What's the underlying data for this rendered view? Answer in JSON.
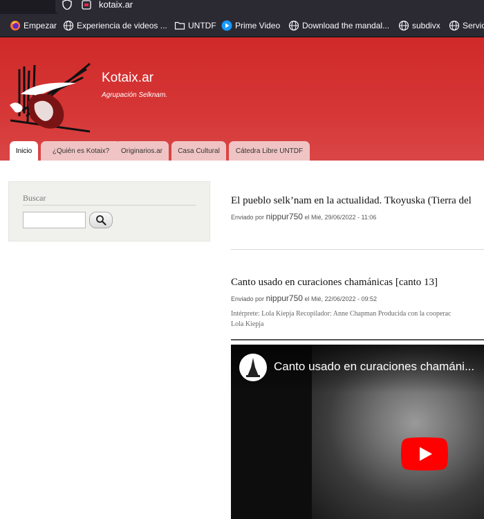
{
  "browser": {
    "url": "kotaix.ar",
    "bookmarks": [
      {
        "label": "Empezar",
        "icon": "firefox-icon"
      },
      {
        "label": "Experiencia de videos ...",
        "icon": "globe-icon"
      },
      {
        "label": "UNTDF",
        "icon": "folder-icon"
      },
      {
        "label": "Prime Video",
        "icon": "prime-video-icon"
      },
      {
        "label": "Download the mandal...",
        "icon": "globe-icon"
      },
      {
        "label": "subdivx",
        "icon": "globe-icon"
      },
      {
        "label": "Servic",
        "icon": "globe-icon"
      }
    ]
  },
  "site": {
    "name": "Kotaix.ar",
    "slogan": "Agrupación Selknam.",
    "header_color": "#d02a2a",
    "tab_color": "#f0c4c4"
  },
  "nav": {
    "tabs": [
      {
        "label": "Inicio",
        "active": true
      },
      {
        "label": "¿Quién es Kotaix?",
        "active": false
      },
      {
        "label": "Originarios.ar",
        "active": false
      },
      {
        "label": "Casa Cultural",
        "active": false
      },
      {
        "label": "Cátedra Libre UNTDF",
        "active": false
      }
    ]
  },
  "sidebar": {
    "search": {
      "title": "Buscar",
      "value": "",
      "button_icon": "magnifier-icon"
    }
  },
  "content": {
    "nodes": [
      {
        "title": "El pueblo selk’nam en la actualidad. Tkoyuska (Tierra del",
        "submitted_prefix": "Enviado por",
        "author": "nippur750",
        "date": "el Mié, 29/06/2022 - 11:06"
      },
      {
        "title": "Canto usado en curaciones chamánicas [canto 13]",
        "submitted_prefix": "Enviado por",
        "author": "nippur750",
        "date": "el Mié, 22/06/2022 - 09:52",
        "body_line1": "Intérprete: Lola Kiepja Recopilador: Anne Chapman Producida con la cooperac",
        "body_line2": "Lola Kiepja",
        "video": {
          "title": "Canto usado en curaciones chamáni...",
          "play_icon": "youtube-play-icon"
        }
      }
    ]
  }
}
